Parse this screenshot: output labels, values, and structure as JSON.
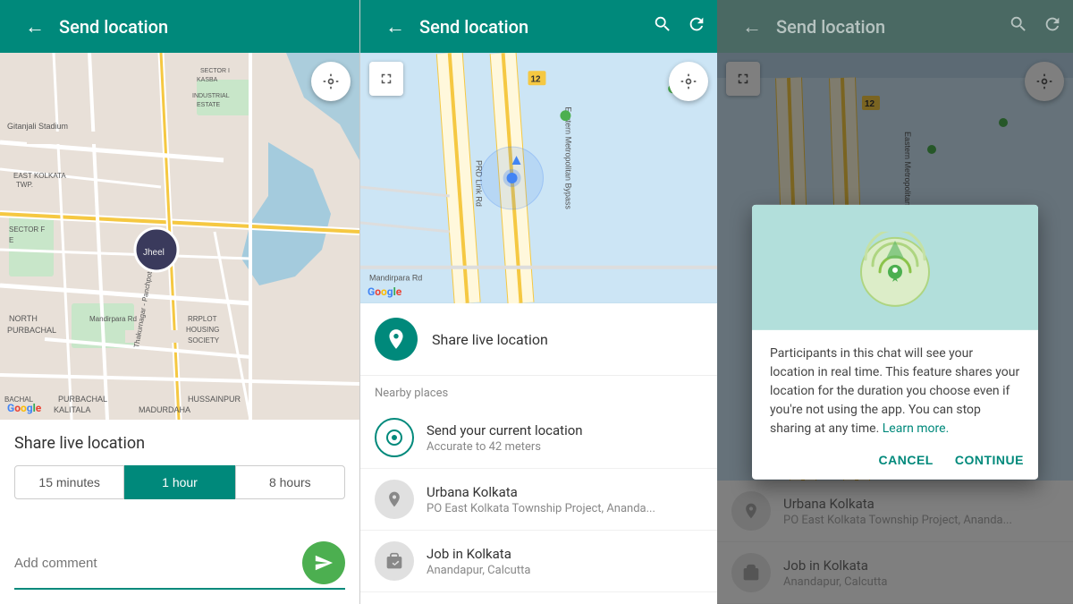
{
  "panels": {
    "left": {
      "header": {
        "title": "Send location",
        "back_icon": "←"
      },
      "bottom": {
        "share_live_label": "Share live location",
        "time_options": [
          {
            "label": "15 minutes",
            "active": false
          },
          {
            "label": "1 hour",
            "active": true
          },
          {
            "label": "8 hours",
            "active": false
          }
        ],
        "comment_placeholder": "Add comment",
        "send_icon": "➤"
      }
    },
    "mid": {
      "header": {
        "title": "Send location",
        "back_icon": "←",
        "search_icon": "🔍",
        "refresh_icon": "↻"
      },
      "share_live": {
        "label": "Share live location",
        "icon": "📡"
      },
      "nearby_label": "Nearby places",
      "places": [
        {
          "name": "Send your current location",
          "sub": "Accurate to 42 meters",
          "type": "current"
        },
        {
          "name": "Urbana Kolkata",
          "sub": "PO East Kolkata Township Project, Ananda...",
          "type": "pin"
        },
        {
          "name": "Job in Kolkata",
          "sub": "Anandapur, Calcutta",
          "type": "suitcase"
        }
      ]
    },
    "right": {
      "header": {
        "title": "Send location",
        "back_icon": "←",
        "search_icon": "🔍",
        "refresh_icon": "↻"
      },
      "dialog": {
        "body_text": "Participants in this chat will see your location in real time. This feature shares your location for the duration you choose even if you're not using the app. You can stop sharing at any time.",
        "learn_more": "Learn more.",
        "cancel_label": "CANCEL",
        "continue_label": "CONTINUE"
      },
      "places": [
        {
          "name": "Urbana Kolkata",
          "sub": "PO East Kolkata Township Project, Ananda...",
          "type": "pin"
        },
        {
          "name": "Job in Kolkata",
          "sub": "Anandapur, Calcutta",
          "type": "suitcase"
        }
      ]
    }
  },
  "colors": {
    "primary": "#00897B",
    "accent_green": "#4CAF50",
    "header_bg": "#00897B",
    "header_dimmed": "#607D8B"
  }
}
